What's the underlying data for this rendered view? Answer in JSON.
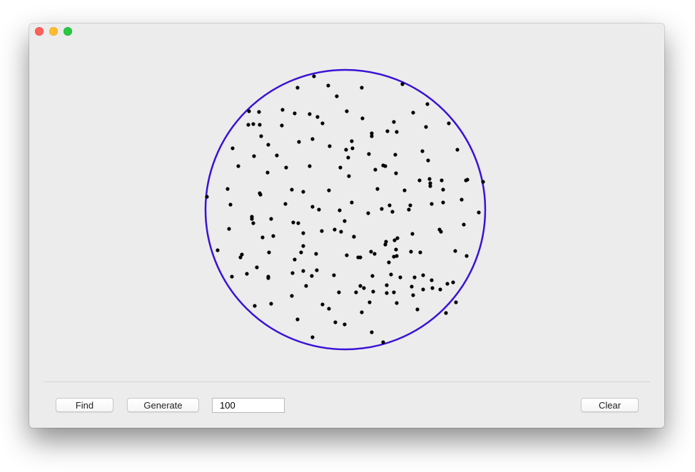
{
  "toolbar": {
    "find_label": "Find",
    "generate_label": "Generate",
    "count_value": "100",
    "clear_label": "Clear"
  },
  "colors": {
    "circle": "#3a12d6",
    "points": "#000000",
    "window_bg": "#ececec"
  },
  "chart_data": {
    "type": "scatter",
    "title": "",
    "xlabel": "",
    "ylabel": "",
    "x_range": [
      0,
      890
    ],
    "y_range": [
      0,
      500
    ],
    "enclosing_circle": {
      "cx": 443,
      "cy": 261,
      "r": 196
    },
    "points": [
      [
        399,
        74
      ],
      [
        376,
        90
      ],
      [
        419,
        87
      ],
      [
        466,
        90
      ],
      [
        523,
        85
      ],
      [
        558,
        113
      ],
      [
        308,
        123
      ],
      [
        322,
        124
      ],
      [
        355,
        121
      ],
      [
        372,
        126
      ],
      [
        393,
        127
      ],
      [
        404,
        131
      ],
      [
        445,
        123
      ],
      [
        431,
        102
      ],
      [
        538,
        125
      ],
      [
        467,
        133
      ],
      [
        307,
        142
      ],
      [
        314,
        141
      ],
      [
        323,
        142
      ],
      [
        354,
        143
      ],
      [
        411,
        140
      ],
      [
        480,
        154
      ],
      [
        480,
        158
      ],
      [
        502,
        151
      ],
      [
        511,
        138
      ],
      [
        515,
        152
      ],
      [
        556,
        145
      ],
      [
        588,
        140
      ],
      [
        325,
        158
      ],
      [
        335,
        170
      ],
      [
        378,
        166
      ],
      [
        397,
        162
      ],
      [
        421,
        172
      ],
      [
        452,
        165
      ],
      [
        444,
        177
      ],
      [
        453,
        175
      ],
      [
        447,
        188
      ],
      [
        476,
        183
      ],
      [
        513,
        184
      ],
      [
        551,
        179
      ],
      [
        559,
        192
      ],
      [
        285,
        175
      ],
      [
        315,
        186
      ],
      [
        347,
        185
      ],
      [
        360,
        202
      ],
      [
        393,
        200
      ],
      [
        436,
        202
      ],
      [
        448,
        214
      ],
      [
        485,
        205
      ],
      [
        496,
        199
      ],
      [
        499,
        200
      ],
      [
        514,
        210
      ],
      [
        561,
        218
      ],
      [
        578,
        220
      ],
      [
        600,
        177
      ],
      [
        612,
        220
      ],
      [
        334,
        209
      ],
      [
        278,
        232
      ],
      [
        293,
        200
      ],
      [
        323,
        238
      ],
      [
        324,
        240
      ],
      [
        368,
        233
      ],
      [
        384,
        236
      ],
      [
        420,
        234
      ],
      [
        452,
        251
      ],
      [
        488,
        232
      ],
      [
        526,
        234
      ],
      [
        547,
        220
      ],
      [
        562,
        224
      ],
      [
        562,
        228
      ],
      [
        580,
        233
      ],
      [
        580,
        251
      ],
      [
        606,
        247
      ],
      [
        614,
        219
      ],
      [
        636,
        222
      ],
      [
        249,
        243
      ],
      [
        282,
        254
      ],
      [
        312,
        271
      ],
      [
        312,
        274
      ],
      [
        314,
        280
      ],
      [
        339,
        274
      ],
      [
        359,
        253
      ],
      [
        370,
        279
      ],
      [
        377,
        280
      ],
      [
        397,
        257
      ],
      [
        406,
        261
      ],
      [
        428,
        289
      ],
      [
        435,
        262
      ],
      [
        442,
        277
      ],
      [
        455,
        299
      ],
      [
        475,
        266
      ],
      [
        494,
        260
      ],
      [
        505,
        255
      ],
      [
        509,
        264
      ],
      [
        532,
        261
      ],
      [
        534,
        255
      ],
      [
        564,
        253
      ],
      [
        575,
        289
      ],
      [
        577,
        292
      ],
      [
        609,
        282
      ],
      [
        630,
        265
      ],
      [
        280,
        288
      ],
      [
        327,
        300
      ],
      [
        336,
        321
      ],
      [
        342,
        298
      ],
      [
        384,
        294
      ],
      [
        384,
        312
      ],
      [
        410,
        291
      ],
      [
        437,
        292
      ],
      [
        455,
        299
      ],
      [
        479,
        320
      ],
      [
        484,
        323
      ],
      [
        500,
        306
      ],
      [
        499,
        310
      ],
      [
        504,
        335
      ],
      [
        516,
        301
      ],
      [
        514,
        317
      ],
      [
        512,
        304
      ],
      [
        515,
        326
      ],
      [
        511,
        327
      ],
      [
        537,
        295
      ],
      [
        548,
        321
      ],
      [
        535,
        320
      ],
      [
        597,
        319
      ],
      [
        613,
        326
      ],
      [
        264,
        318
      ],
      [
        296,
        328
      ],
      [
        298,
        324
      ],
      [
        335,
        357
      ],
      [
        372,
        331
      ],
      [
        381,
        321
      ],
      [
        402,
        323
      ],
      [
        403,
        346
      ],
      [
        427,
        353
      ],
      [
        445,
        325
      ],
      [
        461,
        328
      ],
      [
        464,
        328
      ],
      [
        507,
        352
      ],
      [
        501,
        367
      ],
      [
        501,
        378
      ],
      [
        511,
        377
      ],
      [
        515,
        392
      ],
      [
        540,
        356
      ],
      [
        552,
        353
      ],
      [
        564,
        360
      ],
      [
        565,
        371
      ],
      [
        576,
        373
      ],
      [
        586,
        365
      ],
      [
        319,
        342
      ],
      [
        305,
        351
      ],
      [
        284,
        355
      ],
      [
        335,
        355
      ],
      [
        369,
        350
      ],
      [
        384,
        347
      ],
      [
        368,
        382
      ],
      [
        388,
        368
      ],
      [
        396,
        354
      ],
      [
        411,
        394
      ],
      [
        434,
        377
      ],
      [
        458,
        377
      ],
      [
        469,
        371
      ],
      [
        477,
        391
      ],
      [
        466,
        405
      ],
      [
        442,
        422
      ],
      [
        429,
        419
      ],
      [
        397,
        440
      ],
      [
        420,
        400
      ],
      [
        376,
        415
      ],
      [
        339,
        393
      ],
      [
        316,
        396
      ],
      [
        482,
        376
      ],
      [
        536,
        369
      ],
      [
        552,
        373
      ],
      [
        538,
        381
      ],
      [
        594,
        363
      ],
      [
        598,
        391
      ],
      [
        544,
        401
      ],
      [
        584,
        406
      ],
      [
        480,
        433
      ],
      [
        496,
        447
      ],
      [
        464,
        368
      ],
      [
        520,
        356
      ],
      [
        481,
        354
      ]
    ]
  }
}
